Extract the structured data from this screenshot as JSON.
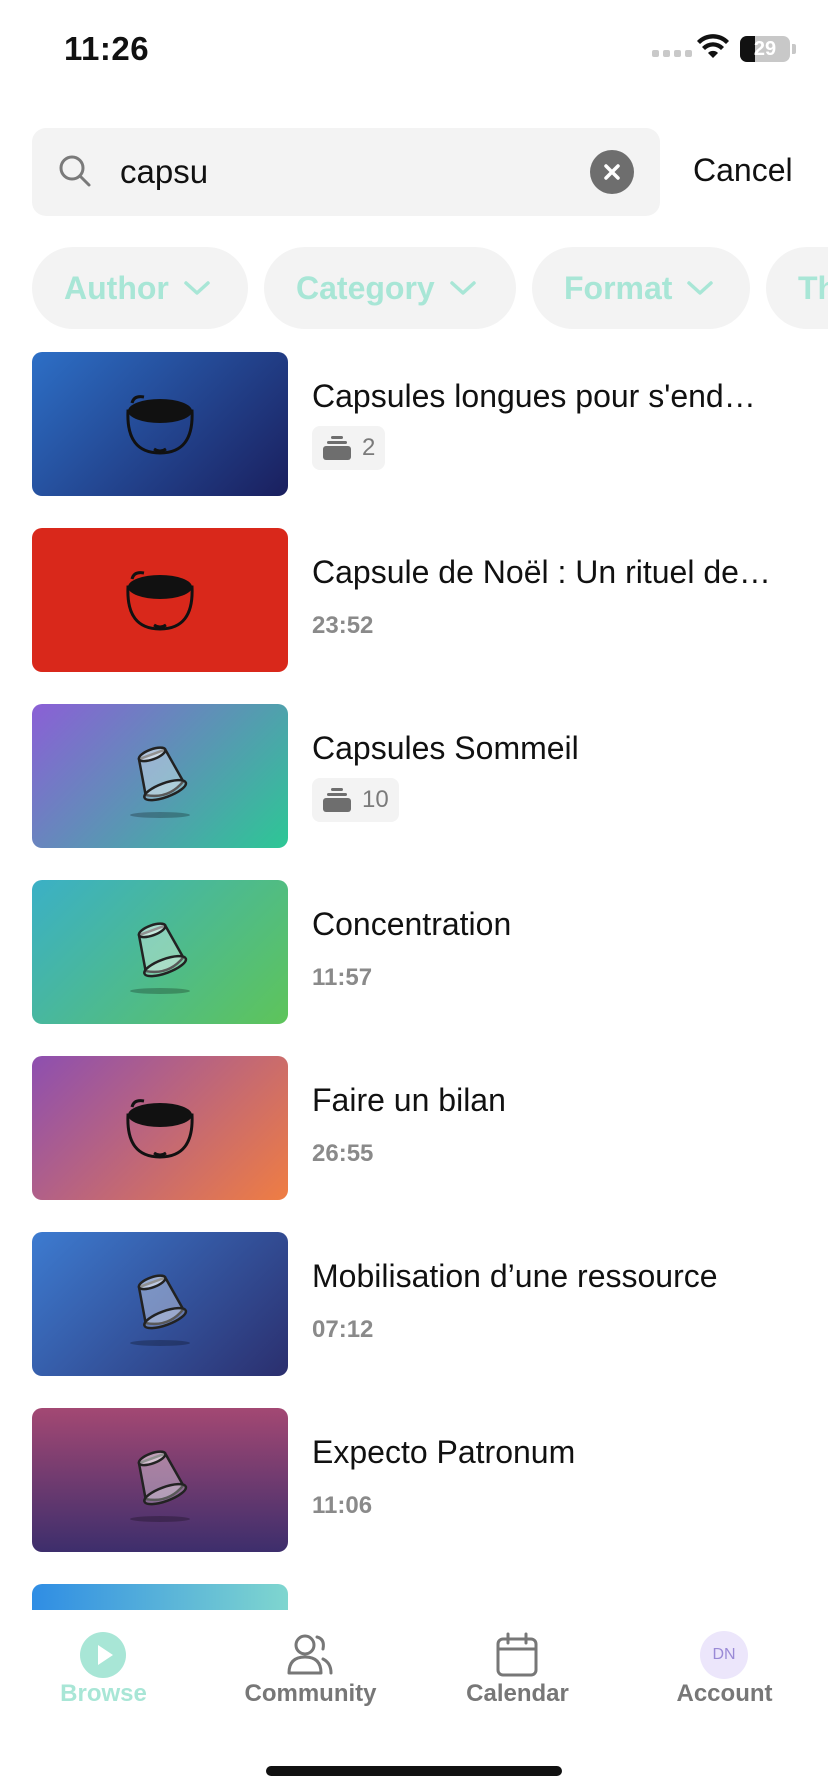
{
  "status": {
    "time": "11:26",
    "battery": "29"
  },
  "search": {
    "value": "capsu",
    "cancel_label": "Cancel"
  },
  "filters": [
    "Author",
    "Category",
    "Format",
    "Th"
  ],
  "results": [
    {
      "title": "Capsules longues pour s'end…",
      "meta": "2",
      "meta_type": "count",
      "thumb_icon": "coffee-cup-icon",
      "colors": [
        "#2d6fc6",
        "#1a1f5e"
      ]
    },
    {
      "title": "Capsule de Noël : Un rituel de…",
      "meta": "23:52",
      "meta_type": "duration",
      "thumb_icon": "coffee-cup-icon",
      "colors": [
        "#d9281b",
        "#d9281b"
      ]
    },
    {
      "title": "Capsules Sommeil",
      "meta": "10",
      "meta_type": "count",
      "thumb_icon": "capsule-icon",
      "colors": [
        "#8b5fd6",
        "#2dc795"
      ]
    },
    {
      "title": "Concentration",
      "meta": "11:57",
      "meta_type": "duration",
      "thumb_icon": "capsule-icon",
      "colors": [
        "#3bb0c6",
        "#5ec45a"
      ]
    },
    {
      "title": "Faire un bilan",
      "meta": "26:55",
      "meta_type": "duration",
      "thumb_icon": "coffee-cup-icon",
      "colors": [
        "#8d4fb0",
        "#ef7d43"
      ]
    },
    {
      "title": "Mobilisation d’une ressource",
      "meta": "07:12",
      "meta_type": "duration",
      "thumb_icon": "capsule-icon",
      "colors": [
        "#3d7bd0",
        "#2b2f6e"
      ]
    },
    {
      "title": "Expecto Patronum",
      "meta": "11:06",
      "meta_type": "duration",
      "thumb_icon": "capsule-icon",
      "colors": [
        "#a34873",
        "#3d2e6c"
      ]
    },
    {
      "title": "",
      "meta": "",
      "meta_type": "none",
      "thumb_icon": "",
      "colors": [
        "#2f8de4",
        "#7fd6cf"
      ]
    }
  ],
  "tabs": [
    {
      "label": "Browse",
      "icon": "play-icon",
      "active": true
    },
    {
      "label": "Community",
      "icon": "people-icon",
      "active": false
    },
    {
      "label": "Calendar",
      "icon": "calendar-icon",
      "active": false
    },
    {
      "label": "Account",
      "icon": "avatar",
      "avatar_text": "DN",
      "active": false
    }
  ],
  "colors": {
    "accent": "#a8e6d6",
    "tab_inactive": "#777777"
  }
}
